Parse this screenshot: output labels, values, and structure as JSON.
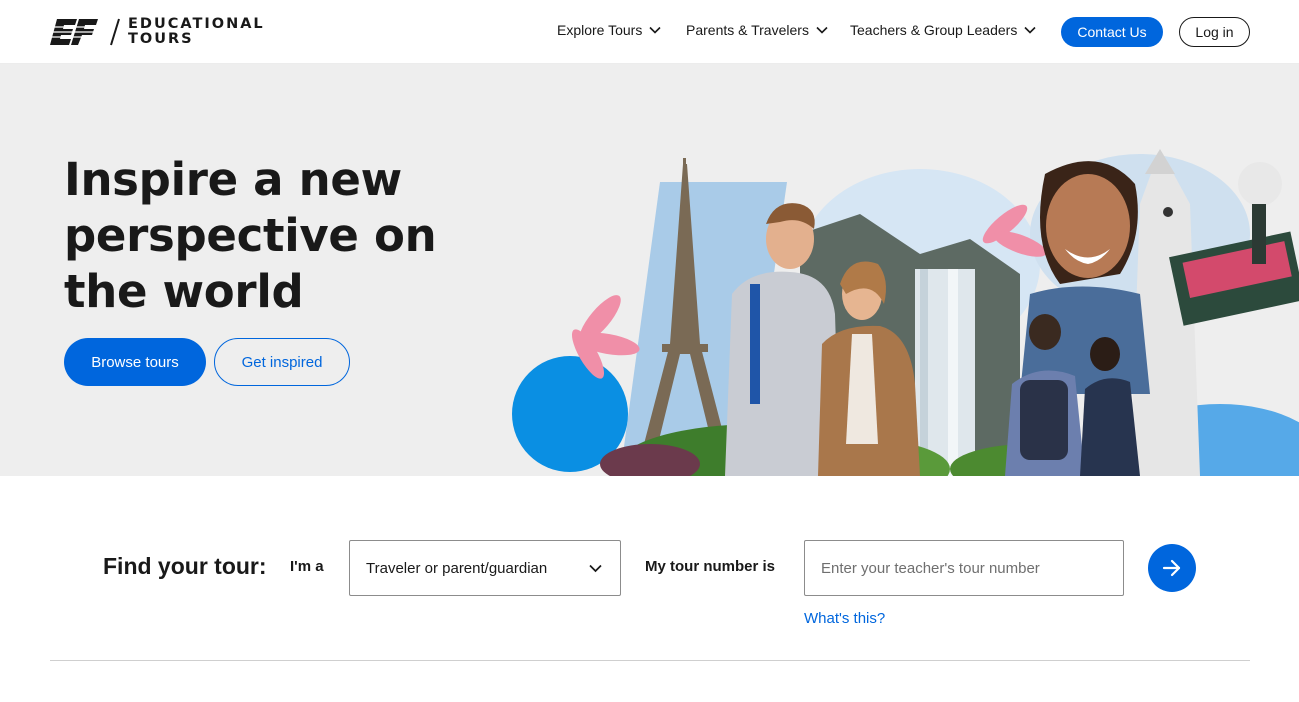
{
  "header": {
    "logo": {
      "mark": "EF",
      "line1": "EDUCATIONAL",
      "line2": "TOURS"
    },
    "nav": [
      {
        "label": "Explore Tours",
        "icon": "chevron-down-icon"
      },
      {
        "label": "Parents & Travelers",
        "icon": "chevron-down-icon"
      },
      {
        "label": "Teachers & Group Leaders",
        "icon": "chevron-down-icon"
      }
    ],
    "contact_label": "Contact Us",
    "login_label": "Log in"
  },
  "hero": {
    "title": "Inspire a new perspective on the world",
    "browse_label": "Browse tours",
    "inspired_label": "Get inspired"
  },
  "find_tour": {
    "heading": "Find your tour:",
    "role_label": "I'm a",
    "role_selected": "Traveler or parent/guardian",
    "tour_number_label": "My tour number is",
    "tour_number_placeholder": "Enter your teacher's tour number",
    "tour_number_value": "",
    "help_link": "What's this?",
    "submit_icon": "arrow-right-icon"
  },
  "colors": {
    "accent": "#0066dd",
    "text": "#191919",
    "hero_bg": "#eeeeee"
  }
}
